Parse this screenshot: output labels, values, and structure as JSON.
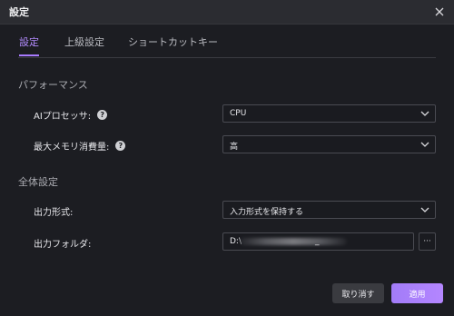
{
  "window": {
    "title": "設定"
  },
  "tabs": [
    {
      "label": "設定",
      "active": true
    },
    {
      "label": "上級設定",
      "active": false
    },
    {
      "label": "ショートカットキー",
      "active": false
    }
  ],
  "sections": {
    "performance": "パフォーマンス",
    "general": "全体設定"
  },
  "fields": {
    "ai_processor": {
      "label": "AIプロセッサ:",
      "value": "CPU"
    },
    "max_memory": {
      "label": "最大メモリ消費量:",
      "value": "高"
    },
    "output_format": {
      "label": "出力形式:",
      "value": "入力形式を保持する"
    },
    "output_folder": {
      "label": "出力フォルダ:",
      "value": "D:\\",
      "value_tail": "_"
    }
  },
  "buttons": {
    "browse": "···",
    "cancel": "取り消す",
    "apply": "適用"
  },
  "help_icon": "?",
  "colors": {
    "accent": "#a87bff",
    "background": "#1c1d22",
    "titlebar": "#2b2c31",
    "cancel_bg": "#3a3b40"
  },
  "icons": [
    "close-icon",
    "help-icon",
    "chevron-down-icon",
    "more-icon"
  ]
}
